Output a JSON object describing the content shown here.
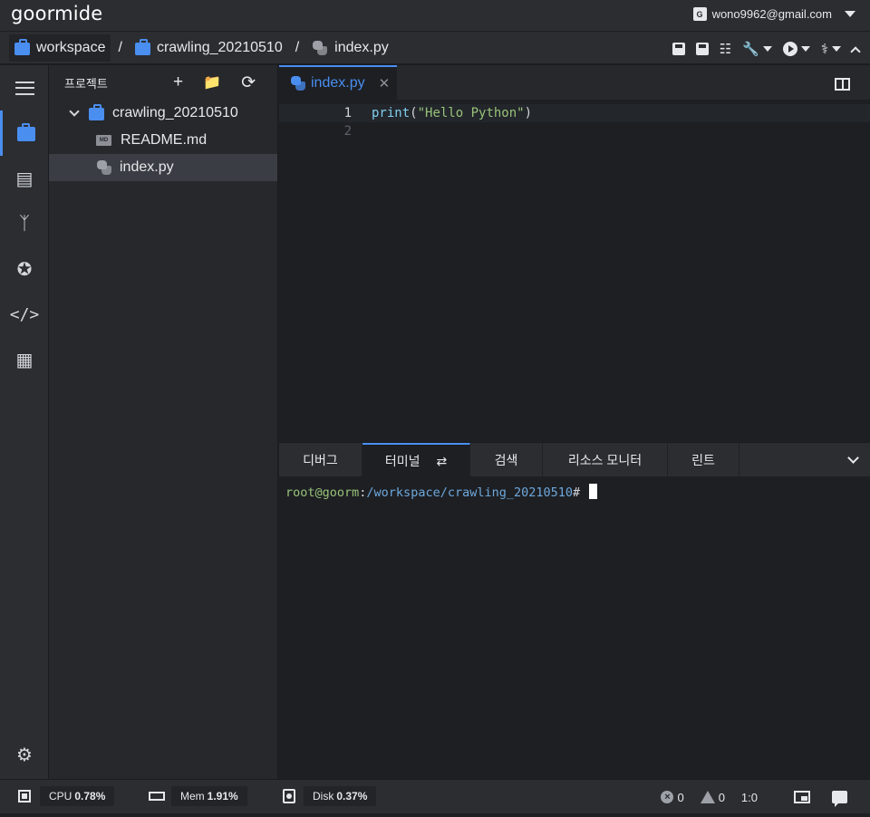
{
  "app": {
    "logo": "goormide",
    "account_email": "wono9962@gmail.com",
    "account_badge": "G"
  },
  "breadcrumb": {
    "items": [
      "workspace",
      "crawling_20210510",
      "index.py"
    ],
    "separator": "/"
  },
  "toolbar": {
    "icons": [
      "save-icon",
      "save-all-icon",
      "search-file-icon",
      "build-tools-icon",
      "run-icon",
      "test-icon",
      "collapse-icon"
    ]
  },
  "activity_bar": {
    "items": [
      "menu-icon",
      "project-icon",
      "editor-icon",
      "git-icon",
      "debug-icon",
      "code-icon",
      "extension-icon",
      "settings-icon"
    ]
  },
  "explorer": {
    "title": "프로젝트",
    "root": "crawling_20210510",
    "files": [
      {
        "name": "README.md",
        "icon": "md-file-icon"
      },
      {
        "name": "index.py",
        "icon": "python-file-icon"
      }
    ]
  },
  "editor": {
    "tab": "index.py",
    "lines": [
      {
        "num": "1",
        "fn": "print",
        "open": "(",
        "str": "\"Hello Python\"",
        "close": ")"
      },
      {
        "num": "2"
      }
    ]
  },
  "panel": {
    "tabs": [
      "디버그",
      "터미널",
      "검색",
      "리소스 모니터",
      "린트"
    ],
    "active_tab": "터미널",
    "terminal": {
      "user": "root@goorm",
      "sep": ":",
      "path": "/workspace/crawling_20210510",
      "prompt": "#"
    }
  },
  "status": {
    "cpu_label": "CPU",
    "cpu": "0.78%",
    "mem_label": "Mem",
    "mem": "1.91%",
    "disk_label": "Disk",
    "disk": "0.37%",
    "errors": "0",
    "warnings": "0",
    "cursor": "1:0"
  },
  "colors": {
    "accent": "#4a8ef0",
    "bg": "#1d1f23",
    "string": "#98c379",
    "user": "#98c379",
    "path": "#6fa8dc"
  }
}
